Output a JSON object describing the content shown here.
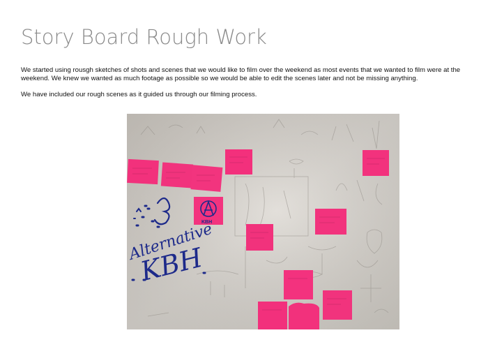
{
  "page": {
    "title": "Story Board Rough Work",
    "paragraphs": [
      "We started using rousgh sketches of shots and scenes that we would like to film over the weekend as most events that we wanted to film were at the weekend. We knew we wanted as much footage as possible so we would be able to edit the scenes later and not be missing anything.",
      "We have included our rough scenes as it guided us through our filming process."
    ]
  },
  "photo": {
    "wall_text_line1": "Alternative",
    "wall_text_line2": "KBH",
    "note_logo_text": "KBH",
    "colors": {
      "wall": "#d9d5cf",
      "sticky_note": "#f4317e",
      "marker": "#1d2a8a"
    }
  }
}
